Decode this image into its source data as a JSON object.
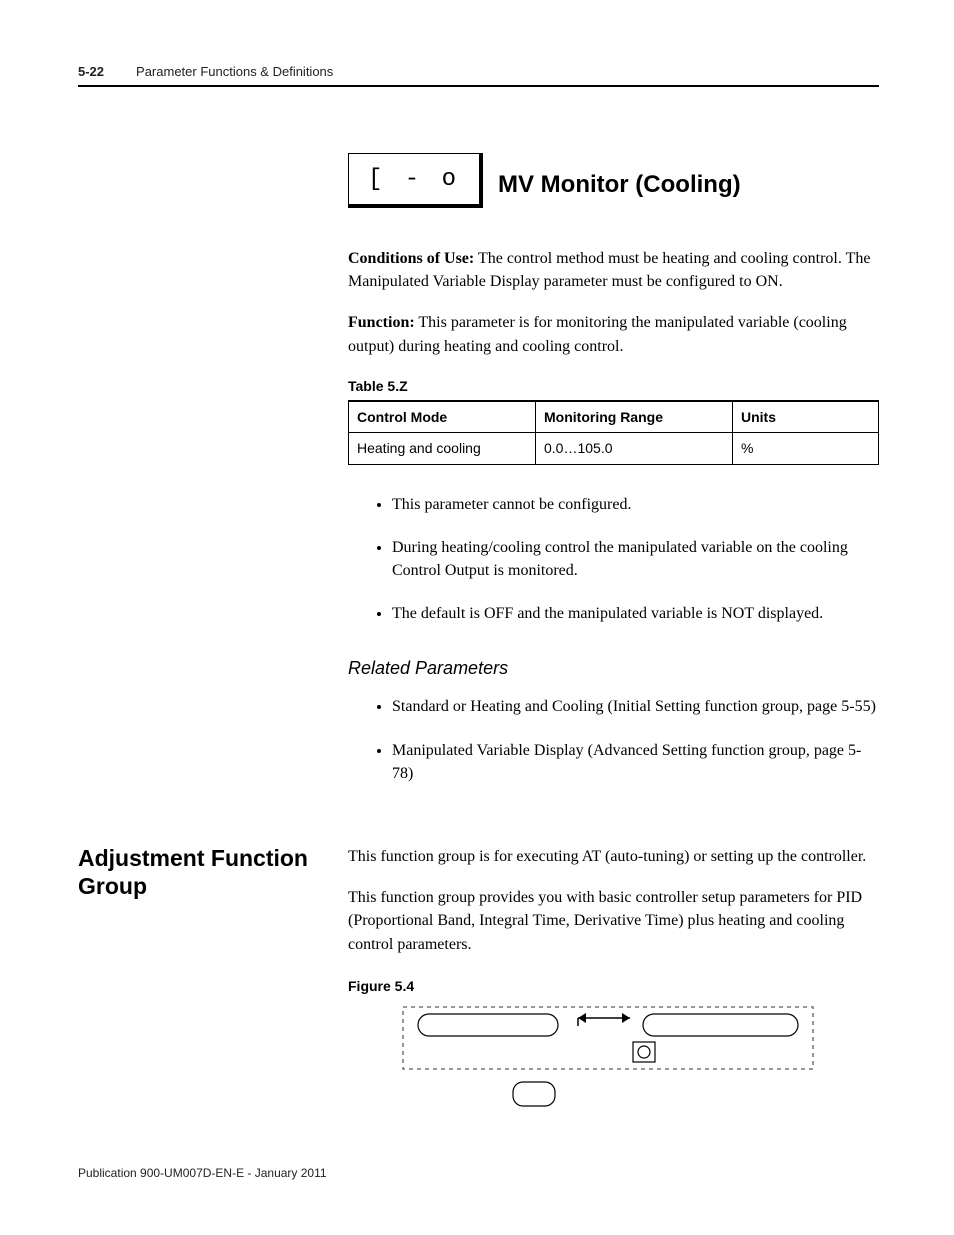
{
  "header": {
    "page_number": "5-22",
    "chapter": "Parameter Functions & Definitions"
  },
  "parameter": {
    "symbol": "[ - o",
    "title": "MV Monitor (Cooling)",
    "conditions_label": "Conditions of Use:",
    "conditions_text": " The control method must be heating and cooling control. The Manipulated Variable Display parameter must be configured to ON.",
    "function_label": "Function:",
    "function_text": " This parameter is for monitoring the manipulated variable (cooling output) during heating and cooling control."
  },
  "table": {
    "caption": "Table 5.Z",
    "header": [
      "Control Mode",
      "Monitoring Range",
      "Units"
    ],
    "row": [
      "Heating and cooling",
      "0.0…105.0",
      "%"
    ]
  },
  "bullets": [
    "This parameter cannot be configured.",
    "During heating/cooling control the manipulated variable on the cooling Control Output is monitored.",
    "The default is OFF and the manipulated variable is NOT displayed."
  ],
  "related": {
    "heading": "Related Parameters",
    "items": [
      "Standard or Heating and Cooling (Initial Setting function group, page 5-55)",
      "Manipulated Variable Display (Advanced Setting function group, page 5-78)"
    ]
  },
  "section": {
    "heading": "Adjustment Function Group",
    "p1": "This function group is for executing AT (auto-tuning) or setting up the controller.",
    "p2": "This function group provides you with basic controller setup parameters for PID (Proportional Band, Integral Time, Derivative Time) plus heating and cooling control parameters."
  },
  "figure": {
    "caption": "Figure 5.4"
  },
  "footer": {
    "publication": "Publication 900-UM007D-EN-E - January 2011"
  }
}
